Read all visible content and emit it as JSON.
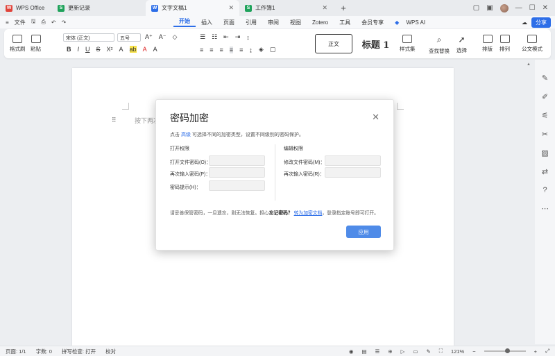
{
  "tabs": [
    {
      "label": "WPS Office",
      "badge": "W",
      "color": "#e0443b"
    },
    {
      "label": "更新记录",
      "badge": "S",
      "color": "#1fa25b"
    },
    {
      "label": "文字文稿1",
      "badge": "W",
      "color": "#2d6ee8"
    },
    {
      "label": "工作簿1",
      "badge": "S",
      "color": "#1fa25b"
    }
  ],
  "menubar": {
    "file_label": "文件",
    "tabs": [
      "开始",
      "插入",
      "页面",
      "引用",
      "审阅",
      "视图",
      "Zotero",
      "工具",
      "会员专享"
    ],
    "ai_label": "WPS AI",
    "share_label": "分享"
  },
  "ribbon": {
    "format_painter": "格式刷",
    "paste": "粘贴",
    "font_name": "宋体 (正文)",
    "font_size": "五号",
    "style_normal": "正文",
    "style_heading": "标题 1",
    "styles_set": "样式集",
    "find_replace": "查找替换",
    "select": "选择",
    "layout": "排版",
    "arrange": "排列",
    "formula_mode": "公文模式"
  },
  "document": {
    "placeholder": "按下两次"
  },
  "dialog": {
    "title": "密码加密",
    "desc_prefix": "点击",
    "desc_link": "高级",
    "desc_suffix": "可选择不同的加密类型，设置不同级别的密码保护。",
    "open_section": "打开权限",
    "edit_section": "编辑权限",
    "open_password_label": "打开文件密码(O)：",
    "open_password_confirm_label": "再次输入密码(P)：",
    "password_hint_label": "密码提示(H)：",
    "edit_password_label": "修改文件密码(M)：",
    "edit_password_confirm_label": "再次输入密码(R)：",
    "note_text": "请妥善保管密码，一旦遗忘，则无法恢复。担心",
    "note_bold": "忘记密码？",
    "note_link": "转为加密文档",
    "note_suffix": "，登录指定账号即可打开。",
    "apply_label": "应用"
  },
  "statusbar": {
    "page": "页面: 1/1",
    "words": "字数: 0",
    "spellcheck": "拼写检查: 打开",
    "proofread": "校对",
    "zoom": "121%"
  }
}
